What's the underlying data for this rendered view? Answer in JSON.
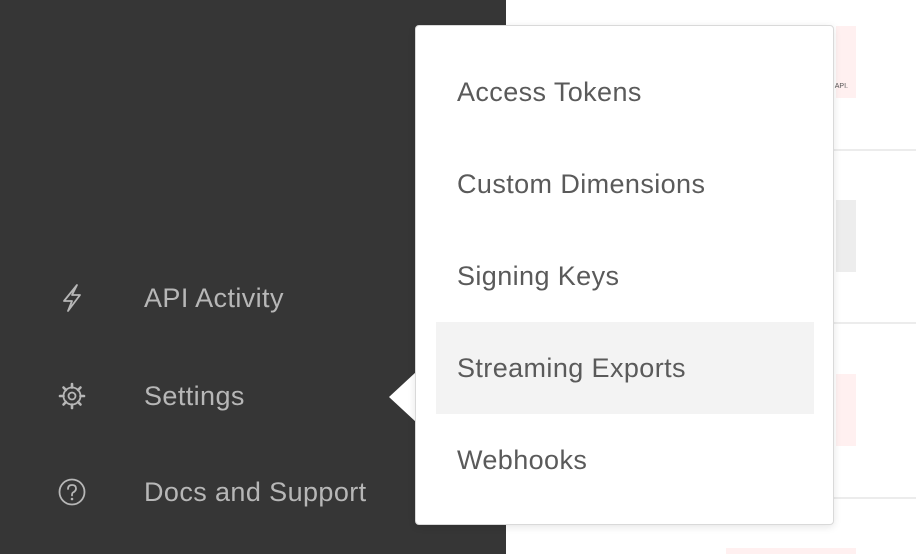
{
  "sidebar": {
    "items": [
      {
        "label": "API Activity",
        "icon": "lightning-icon"
      },
      {
        "label": "Settings",
        "icon": "gear-icon"
      },
      {
        "label": "Docs and Support",
        "icon": "help-circle-icon"
      }
    ]
  },
  "settings_menu": {
    "items": [
      {
        "label": "Access Tokens"
      },
      {
        "label": "Custom Dimensions"
      },
      {
        "label": "Signing Keys"
      },
      {
        "label": "Streaming Exports",
        "highlighted": true
      },
      {
        "label": "Webhooks"
      }
    ]
  },
  "background": {
    "snippet_text": "API."
  },
  "colors": {
    "sidebar_bg": "#363636",
    "sidebar_text": "#b7b7b7",
    "menu_text": "#5a5a5a",
    "menu_highlight": "#f3f3f3",
    "thumb_pink": "#fff0f0"
  }
}
